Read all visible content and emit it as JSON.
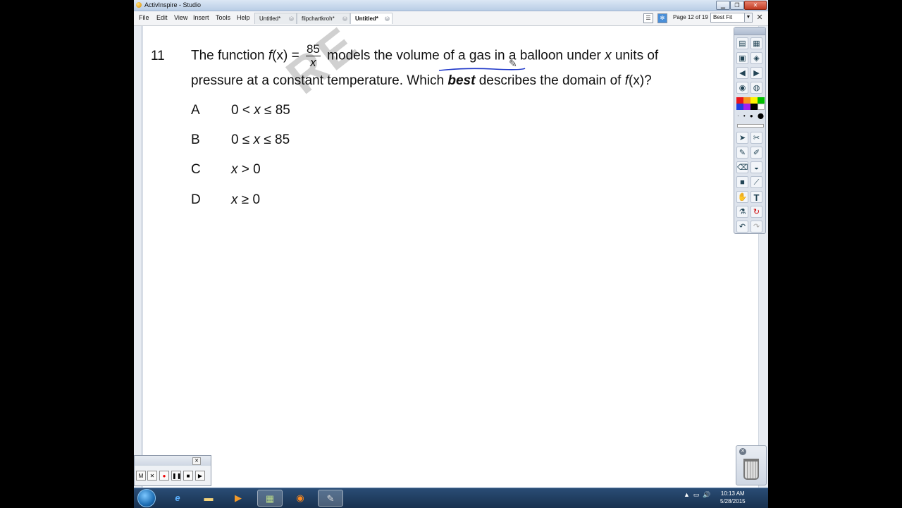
{
  "window": {
    "title": "ActivInspire - Studio"
  },
  "menu": [
    "File",
    "Edit",
    "View",
    "Insert",
    "Tools",
    "Help"
  ],
  "tabs": [
    {
      "label": "Untitled*",
      "active": false
    },
    {
      "label": "flipchartkroh*",
      "active": false
    },
    {
      "label": "Untitled*",
      "active": true
    }
  ],
  "pager": {
    "page_label": "Page 12 of 19",
    "zoom": "Best Fit"
  },
  "question": {
    "number": "11",
    "line1_pre": "The function",
    "fx": "f",
    "fx_var": "(x)",
    "equals": "=",
    "frac_num": "85",
    "frac_den": "x",
    "line1_post": "models the volume of a gas in a balloon under",
    "var_x": "x",
    "line1_end": "units of",
    "line2_pre": "pressure at a constant temperature. Which",
    "best": "best",
    "line2_post": "describes the domain of",
    "fx2": "f",
    "fx2_var": "(x)?"
  },
  "options": [
    {
      "letter": "A",
      "pre": "0 <",
      "var": "x",
      "post": "≤ 85"
    },
    {
      "letter": "B",
      "pre": "0 ≤",
      "var": "x",
      "post": "≤ 85"
    },
    {
      "letter": "C",
      "pre": "",
      "var": "x",
      "post": "> 0"
    },
    {
      "letter": "D",
      "pre": "",
      "var": "x",
      "post": "≥ 0"
    }
  ],
  "watermark": "RE",
  "palette_colors": [
    "#e8141c",
    "#f7941d",
    "#fff200",
    "#00c000",
    "#1f3fe0",
    "#a020f0",
    "#000000",
    "#ffffff"
  ],
  "recorder": {
    "buttons": [
      "M",
      "✕",
      "●",
      "❚❚",
      "■",
      "▶"
    ]
  },
  "taskbar": {
    "time": "10:13 AM",
    "date": "5/28/2015"
  },
  "colors": {
    "ink": "#1c35c8",
    "taskbar": "#1f3d63"
  }
}
